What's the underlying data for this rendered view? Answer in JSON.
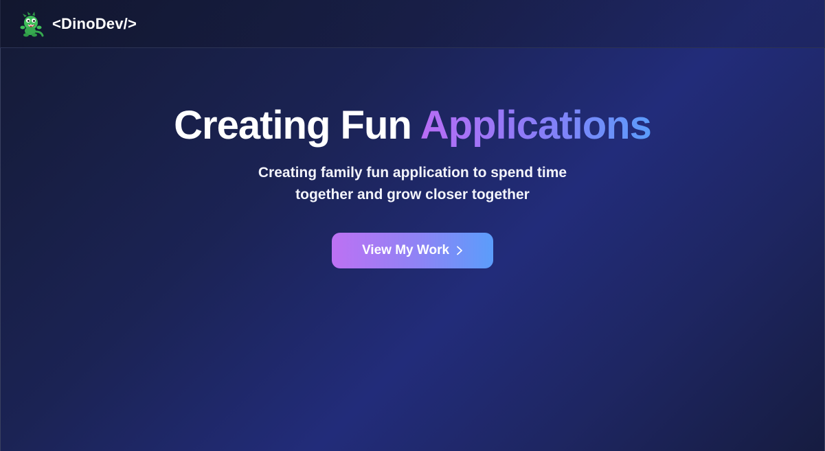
{
  "header": {
    "brand_text": "<DinoDev/>",
    "logo_icon": "dinosaur-icon"
  },
  "hero": {
    "title_main": "Creating Fun",
    "title_accent": "Applications",
    "subtitle": "Creating family fun application to spend time together and grow closer together",
    "cta_label": "View My Work",
    "cta_icon": "chevron-right-icon"
  },
  "colors": {
    "accent_start": "#b86df5",
    "accent_end": "#5b9cfb",
    "logo_green": "#3fbf5a"
  }
}
